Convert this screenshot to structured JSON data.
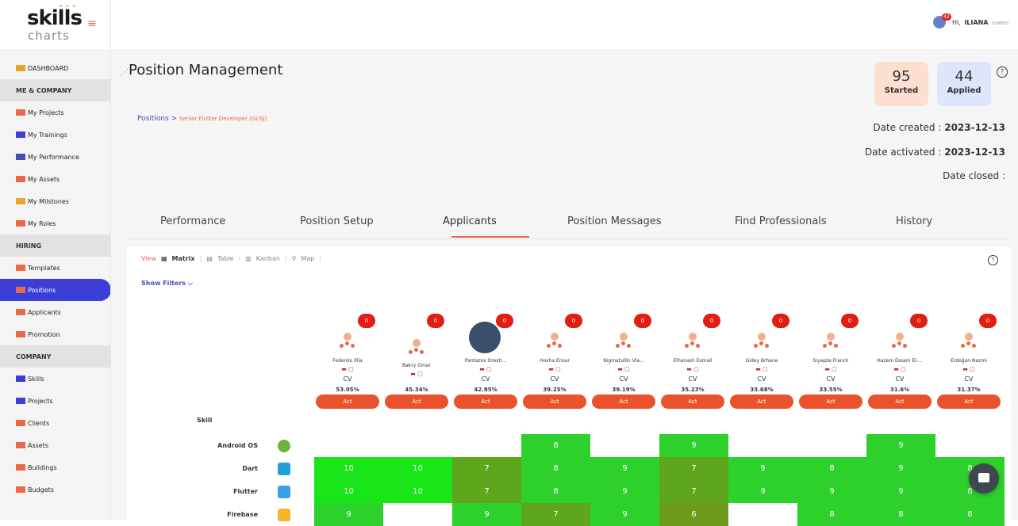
{
  "app": {
    "logo_top": "skills",
    "logo_bottom": "charts"
  },
  "header": {
    "greeting": "Hi,",
    "user": "ILIANA",
    "user_small": "SOMERS",
    "notifications": "42"
  },
  "sidebar": {
    "items": [
      {
        "label": "DASHBOARD",
        "type": "item"
      },
      {
        "label": "ME & COMPANY",
        "type": "section"
      },
      {
        "label": "My Projects",
        "type": "item"
      },
      {
        "label": "My Trainings",
        "type": "item"
      },
      {
        "label": "My Performance",
        "type": "item"
      },
      {
        "label": "My Assets",
        "type": "item"
      },
      {
        "label": "My Milstones",
        "type": "item"
      },
      {
        "label": "My Roles",
        "type": "item"
      },
      {
        "label": "HIRING",
        "type": "section"
      },
      {
        "label": "Templates",
        "type": "item"
      },
      {
        "label": "Positions",
        "type": "active"
      },
      {
        "label": "Applicants",
        "type": "item"
      },
      {
        "label": "Promotion",
        "type": "item"
      },
      {
        "label": "COMPANY",
        "type": "section"
      },
      {
        "label": "Skills",
        "type": "item"
      },
      {
        "label": "Projects",
        "type": "item"
      },
      {
        "label": "Clients",
        "type": "item"
      },
      {
        "label": "Assets",
        "type": "item"
      },
      {
        "label": "Buildings",
        "type": "item"
      },
      {
        "label": "Budgets",
        "type": "item"
      }
    ]
  },
  "page": {
    "title": "Position Management",
    "breadcrumb": {
      "root": "Positions",
      "sep": ">",
      "current": "Senior Flutter Developer (GUSJ)"
    },
    "stats": {
      "started_value": "95",
      "started_label": "Started",
      "applied_value": "44",
      "applied_label": "Applied"
    },
    "dates": {
      "created_label": "Date created :",
      "created_value": "2023-12-13",
      "activated_label": "Date activated :",
      "activated_value": "2023-12-13",
      "closed_label": "Date closed :"
    },
    "tabs": [
      "Performance",
      "Position Setup",
      "Applicants",
      "Position Messages",
      "Find Professionals",
      "History"
    ]
  },
  "view": {
    "label": "View",
    "options": [
      "Matrix",
      "Table",
      "Kanban",
      "Map"
    ],
    "show_filters": "Show Filters"
  },
  "matrix": {
    "skill_header": "Skill",
    "act_label": "Act",
    "cv_label": "CV",
    "candidates": [
      {
        "name": "Fedenko Illia",
        "badge": "0",
        "score": "53.05%"
      },
      {
        "name": "Bakry Omar",
        "badge": "0",
        "score": "45.34%"
      },
      {
        "name": "Pantazos Oresti...",
        "badge": "0",
        "score": "42.85%"
      },
      {
        "name": "Hoxha Ensar",
        "badge": "0",
        "score": "39.25%"
      },
      {
        "name": "Nigmatullin Vla...",
        "badge": "0",
        "score": "39.19%"
      },
      {
        "name": "Elhanash Esmail",
        "badge": "0",
        "score": "35.23%"
      },
      {
        "name": "Gidey Brhane",
        "badge": "0",
        "score": "33.68%"
      },
      {
        "name": "Siyapze Franck",
        "badge": "0",
        "score": "33.55%"
      },
      {
        "name": "Hazem Essam El-...",
        "badge": "0",
        "score": "31.6%"
      },
      {
        "name": "Erdoğan Nazmi",
        "badge": "0",
        "score": "31.37%"
      }
    ],
    "skills": [
      {
        "name": "Android OS",
        "values": [
          "",
          "",
          "",
          "8",
          "",
          "9",
          "",
          "",
          "9",
          ""
        ]
      },
      {
        "name": "Dart",
        "values": [
          "10",
          "10",
          "7",
          "8",
          "9",
          "7",
          "9",
          "8",
          "9",
          "8"
        ]
      },
      {
        "name": "Flutter",
        "values": [
          "10",
          "10",
          "7",
          "8",
          "9",
          "7",
          "9",
          "9",
          "9",
          "8"
        ]
      },
      {
        "name": "Firebase",
        "values": [
          "9",
          "",
          "9",
          "7",
          "9",
          "6",
          "",
          "8",
          "8",
          "8"
        ]
      }
    ]
  },
  "colors": {
    "accent": "#e9522c",
    "nav_active": "#3b3fd8",
    "cell_bright": "#19e619",
    "cell_mid": "#2ed12b",
    "cell_dark": "#5ea61c",
    "cell_darker": "#6e9a1c"
  }
}
